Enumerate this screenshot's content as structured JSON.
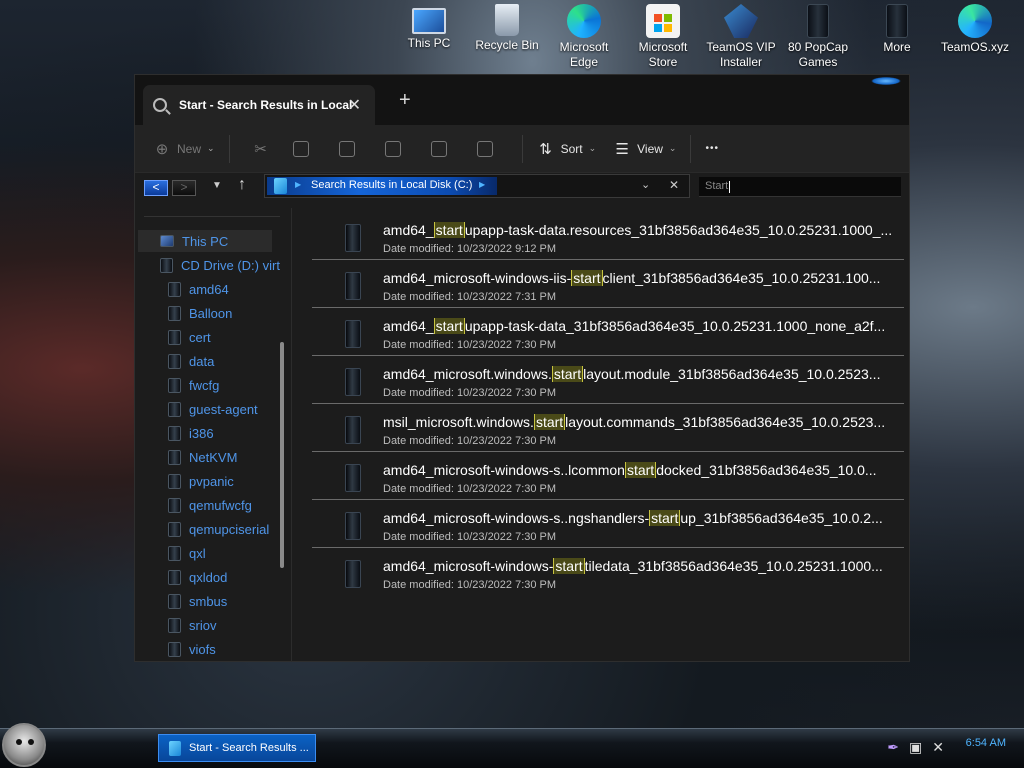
{
  "desktop": {
    "icons": [
      {
        "label": "This PC",
        "icon": "this-pc-icon"
      },
      {
        "label": "Recycle Bin",
        "icon": "recycle-bin-icon"
      },
      {
        "label": "Microsoft Edge",
        "icon": "edge-icon"
      },
      {
        "label": "Microsoft Store",
        "icon": "store-icon"
      },
      {
        "label": "TeamOS VIP Installer",
        "icon": "teamos-icon"
      },
      {
        "label": "80 PopCap Games",
        "icon": "popcap-icon"
      },
      {
        "label": "More",
        "icon": "more-icon"
      },
      {
        "label": "TeamOS.xyz",
        "icon": "teamos-xyz-icon"
      }
    ]
  },
  "window": {
    "tab_title": "Start - Search Results in Local",
    "new_tab": "+",
    "toolbar": {
      "new_label": "New",
      "sort_label": "Sort",
      "view_label": "View",
      "more_label": "•••"
    },
    "address": {
      "text": "Search Results in Local Disk (C:)"
    },
    "search": {
      "value": "Start"
    },
    "sidebar": {
      "items": [
        {
          "label": "This PC"
        },
        {
          "label": "CD Drive (D:) virt"
        },
        {
          "label": "amd64"
        },
        {
          "label": "Balloon"
        },
        {
          "label": "cert"
        },
        {
          "label": "data"
        },
        {
          "label": "fwcfg"
        },
        {
          "label": "guest-agent"
        },
        {
          "label": "i386"
        },
        {
          "label": "NetKVM"
        },
        {
          "label": "pvpanic"
        },
        {
          "label": "qemufwcfg"
        },
        {
          "label": "qemupciserial"
        },
        {
          "label": "qxl"
        },
        {
          "label": "qxldod"
        },
        {
          "label": "smbus"
        },
        {
          "label": "sriov"
        },
        {
          "label": "viofs"
        }
      ]
    },
    "results": [
      {
        "pre": "amd64_",
        "match": "start",
        "post": "upapp-task-data.resources_31bf3856ad364e35_10.0.25231.1000_...",
        "date": "Date modified: 10/23/2022 9:12 PM"
      },
      {
        "pre": "amd64_microsoft-windows-iis-",
        "match": "start",
        "post": "client_31bf3856ad364e35_10.0.25231.100...",
        "date": "Date modified: 10/23/2022 7:31 PM"
      },
      {
        "pre": "amd64_",
        "match": "start",
        "post": "upapp-task-data_31bf3856ad364e35_10.0.25231.1000_none_a2f...",
        "date": "Date modified: 10/23/2022 7:30 PM"
      },
      {
        "pre": "amd64_microsoft.windows.",
        "match": "start",
        "post": "layout.module_31bf3856ad364e35_10.0.2523...",
        "date": "Date modified: 10/23/2022 7:30 PM"
      },
      {
        "pre": "msil_microsoft.windows.",
        "match": "start",
        "post": "layout.commands_31bf3856ad364e35_10.0.2523...",
        "date": "Date modified: 10/23/2022 7:30 PM"
      },
      {
        "pre": "amd64_microsoft-windows-s..lcommon",
        "match": "start",
        "post": "docked_31bf3856ad364e35_10.0...",
        "date": "Date modified: 10/23/2022 7:30 PM"
      },
      {
        "pre": "amd64_microsoft-windows-s..ngshandlers-",
        "match": "start",
        "post": "up_31bf3856ad364e35_10.0.2...",
        "date": "Date modified: 10/23/2022 7:30 PM"
      },
      {
        "pre": "amd64_microsoft-windows-",
        "match": "start",
        "post": "tiledata_31bf3856ad364e35_10.0.25231.1000...",
        "date": "Date modified: 10/23/2022 7:30 PM"
      }
    ]
  },
  "taskbar": {
    "task_label": "Start - Search Results ...",
    "clock": "6:54 AM"
  }
}
